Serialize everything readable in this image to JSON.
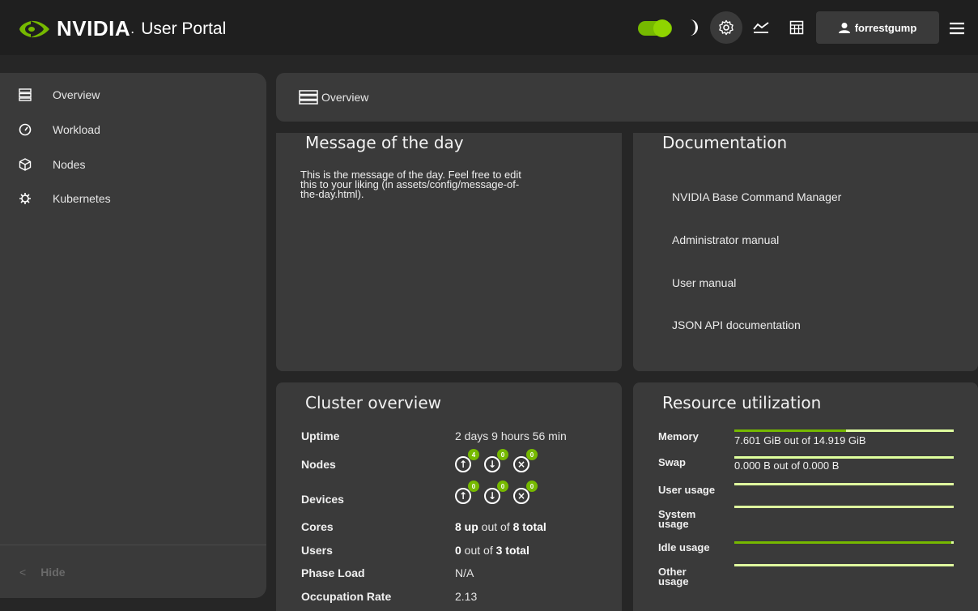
{
  "app": {
    "brand": "NVIDIA",
    "portal": "User Portal",
    "username": "forrestgump"
  },
  "theme": {
    "accent": "#76b900",
    "bar_track": "#dfff9e",
    "dark_mode": true
  },
  "icons": {
    "theme_toggle": "toggle-icon",
    "dark_mode": "moon-icon",
    "settings": "gear-icon",
    "monitoring": "chart-line-icon",
    "calculator": "calculator-icon",
    "user": "user-icon",
    "menu": "hamburger-menu-icon"
  },
  "sidebar": {
    "items": [
      {
        "label": "Overview",
        "icon": "server-stack-icon"
      },
      {
        "label": "Workload",
        "icon": "gauge-icon"
      },
      {
        "label": "Nodes",
        "icon": "cube-icon"
      },
      {
        "label": "Kubernetes",
        "icon": "kubernetes-icon"
      }
    ],
    "hide_label": "Hide"
  },
  "breadcrumb": {
    "label": "Overview"
  },
  "motd": {
    "title": "Message of the day",
    "lines": [
      "This is the message of the day. Feel free to edit",
      "this to your liking (in assets/config/message-of-",
      "the-day.html)."
    ]
  },
  "documentation": {
    "title": "Documentation",
    "links": [
      "NVIDIA Base Command Manager",
      "Administrator manual",
      "User manual",
      "JSON API documentation"
    ]
  },
  "cluster": {
    "title": "Cluster overview",
    "uptime": {
      "label": "Uptime",
      "value": "2 days 9 hours 56 min"
    },
    "nodes": {
      "label": "Nodes",
      "up": "4",
      "down": "0",
      "closed": "0"
    },
    "devices": {
      "label": "Devices",
      "up": "0",
      "down": "0",
      "closed": "0"
    },
    "cores": {
      "label": "Cores",
      "up": "8 up",
      "mid": " out of ",
      "total": "8 total"
    },
    "users": {
      "label": "Users",
      "count": "0",
      "mid": " out of ",
      "total": "3 total"
    },
    "phase_load": {
      "label": "Phase Load",
      "value": "N/A"
    },
    "occupation_rate": {
      "label": "Occupation Rate",
      "value": "2.13"
    }
  },
  "resource": {
    "title": "Resource utilization",
    "memory": {
      "label": "Memory",
      "text": "7.601 GiB out of 14.919 GiB",
      "fraction": 0.51
    },
    "swap": {
      "label": "Swap",
      "text": "0.000 B out of 0.000 B",
      "fraction": 0
    },
    "user_usage": {
      "label": "User usage",
      "fraction": 0
    },
    "system_usage": {
      "label1": "System",
      "label2": "usage",
      "fraction": 0
    },
    "idle_usage": {
      "label": "Idle usage",
      "fraction": 0.99
    },
    "other_usage": {
      "label1": "Other",
      "label2": "usage",
      "fraction": 0
    }
  }
}
